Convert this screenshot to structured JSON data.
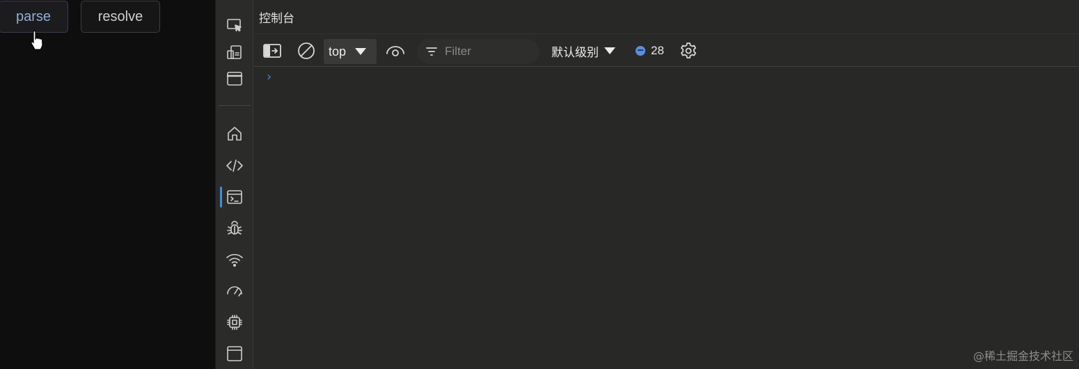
{
  "page": {
    "buttons": [
      {
        "label": "parse"
      },
      {
        "label": "resolve"
      }
    ]
  },
  "devtools": {
    "title": "控制台",
    "activity_bar": [
      {
        "icon": "inspect-pointer-icon"
      },
      {
        "icon": "device-toggle-icon"
      },
      {
        "icon": "browser-window-icon"
      },
      {
        "icon": "home-icon"
      },
      {
        "icon": "elements-code-icon"
      },
      {
        "icon": "console-icon",
        "active": true
      },
      {
        "icon": "bug-icon"
      },
      {
        "icon": "wifi-network-icon"
      },
      {
        "icon": "performance-gauge-icon"
      },
      {
        "icon": "cpu-chip-icon"
      },
      {
        "icon": "panel-layout-icon"
      }
    ],
    "toolbar": {
      "context": "top",
      "filter_placeholder": "Filter",
      "level": "默认级别",
      "message_count": "28"
    },
    "console": {
      "prompt": "›"
    },
    "accent_color": "#3d8fe0"
  },
  "watermark": "@稀土掘金技术社区"
}
